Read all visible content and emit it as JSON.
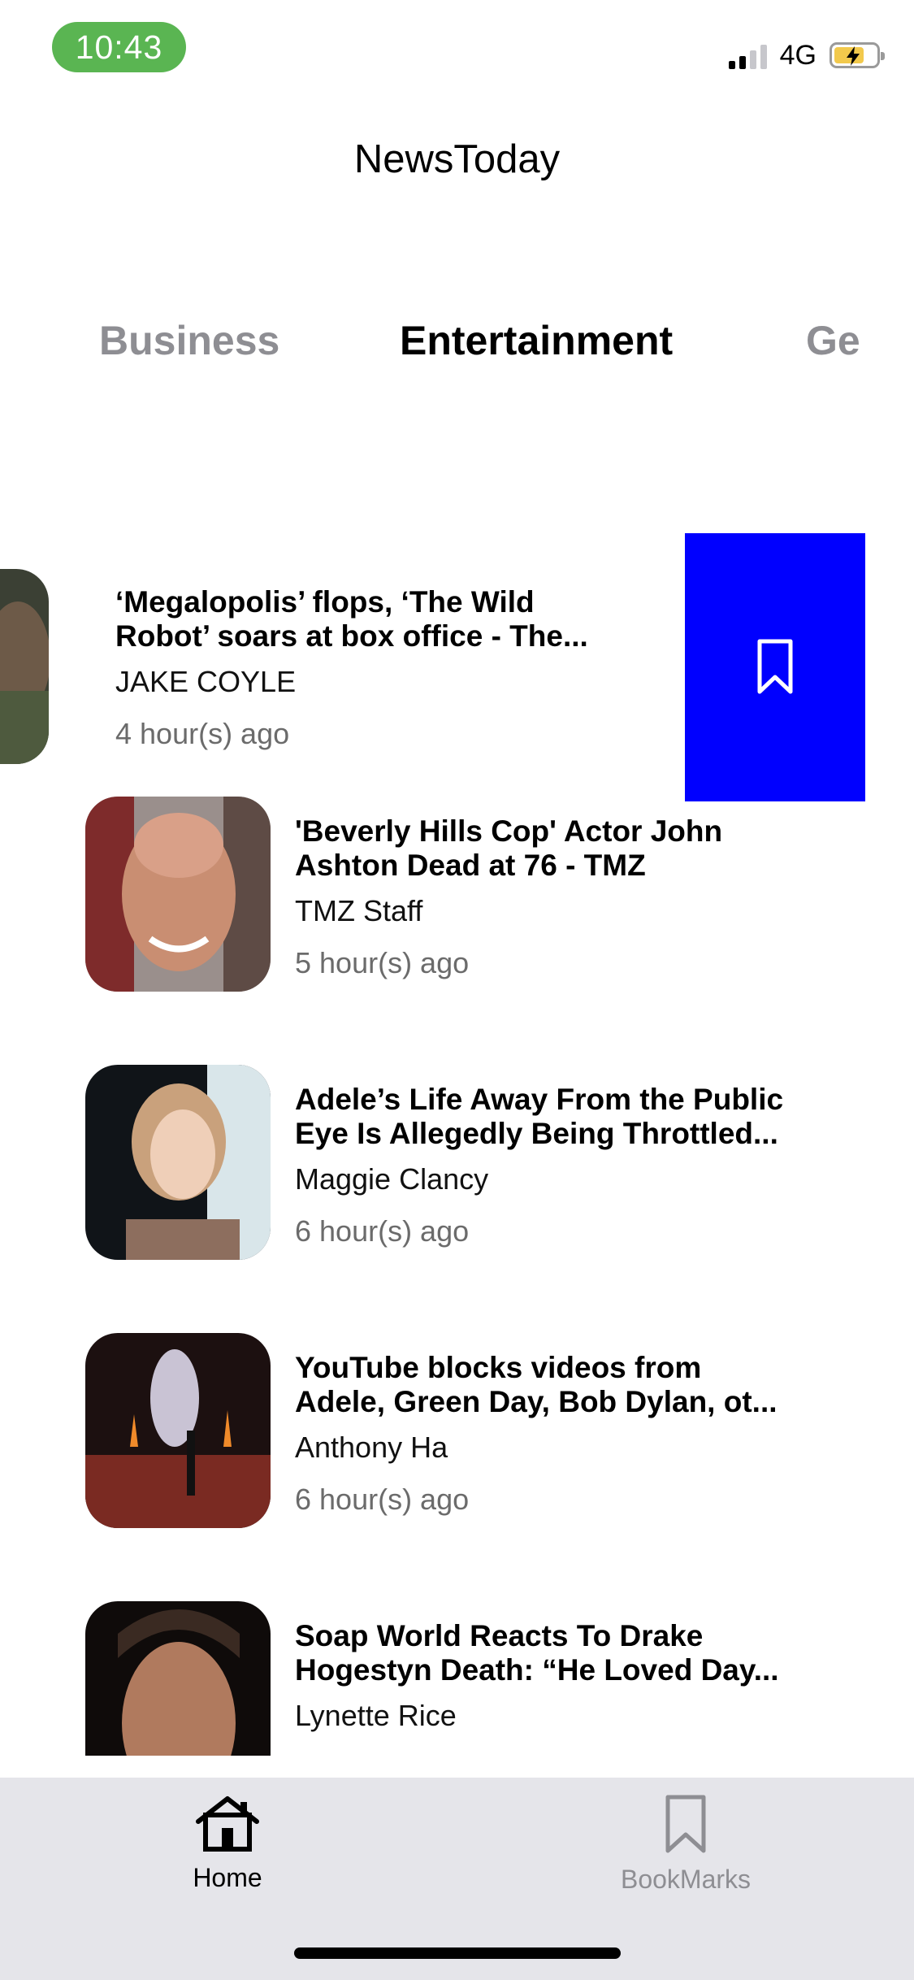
{
  "status_bar": {
    "time": "10:43",
    "network": "4G",
    "signal_bars": 2,
    "battery_level": 0.6,
    "time_pill_color": "#5ab552"
  },
  "header": {
    "title": "NewsToday"
  },
  "categories": [
    {
      "label": "Business",
      "active": false
    },
    {
      "label": "Entertainment",
      "active": true
    },
    {
      "label": "Ge",
      "active": false
    }
  ],
  "articles": [
    {
      "headline_line1": "‘Megalopolis’ flops, ‘The Wild",
      "headline_line2": "Robot’ soars at box office - The...",
      "author": "JAKE COYLE",
      "time": "4 hour(s) ago",
      "swiped": true
    },
    {
      "headline_line1": "'Beverly Hills Cop' Actor John",
      "headline_line2": "Ashton Dead at 76 - TMZ",
      "author": "TMZ Staff",
      "time": "5 hour(s) ago"
    },
    {
      "headline_line1": "Adele’s Life Away From the Public",
      "headline_line2": "Eye Is Allegedly Being Throttled...",
      "author": "Maggie Clancy",
      "time": "6 hour(s) ago"
    },
    {
      "headline_line1": "YouTube blocks videos from",
      "headline_line2": "Adele, Green Day, Bob Dylan, ot...",
      "author": "Anthony Ha",
      "time": "6 hour(s) ago"
    },
    {
      "headline_line1": "Soap World Reacts To Drake",
      "headline_line2": "Hogestyn Death: “He Loved Day...",
      "author": "Lynette Rice",
      "time": ""
    }
  ],
  "swipe_action": {
    "icon": "bookmark-icon",
    "color": "#0000ff"
  },
  "tab_bar": {
    "items": [
      {
        "label": "Home",
        "icon": "home-icon",
        "active": true
      },
      {
        "label": "BookMarks",
        "icon": "bookmark-icon",
        "active": false
      }
    ]
  }
}
